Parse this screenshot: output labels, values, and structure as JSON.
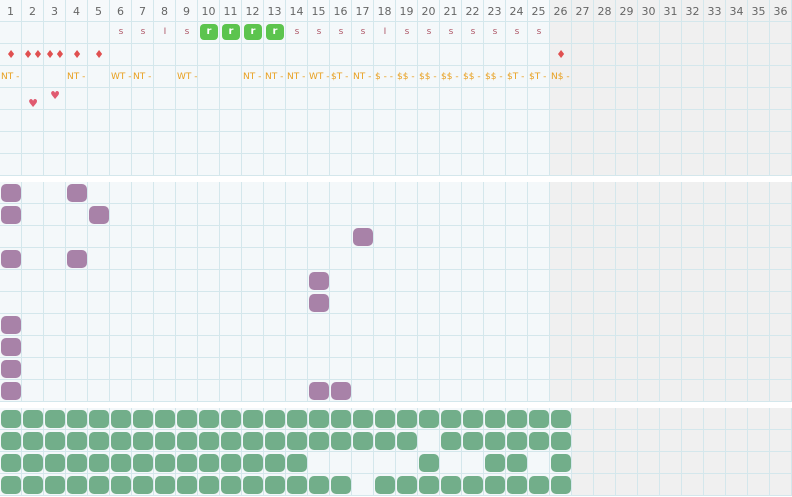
{
  "columns": [
    "1",
    "2",
    "3",
    "4",
    "5",
    "6",
    "7",
    "8",
    "9",
    "10",
    "11",
    "12",
    "13",
    "14",
    "15",
    "16",
    "17",
    "18",
    "19",
    "20",
    "21",
    "22",
    "23",
    "24",
    "25",
    "26",
    "27",
    "28",
    "29",
    "30",
    "31",
    "32",
    "33",
    "34",
    "35",
    "36"
  ],
  "active_columns": 25,
  "colors": {
    "active_bg": "#f4f8fa",
    "inactive_bg": "#f0f0f0",
    "header_bg": "#f6f9fb",
    "green_badge": "#5cc44e",
    "purple_blob": "#a882a8",
    "green_blob": "#72ae8a",
    "code_text": "#e8a020",
    "drop_red": "#e05050",
    "heart_pink": "#e05a70",
    "s_mark": "#b05a6a"
  },
  "top_marks": [
    "",
    "",
    "",
    "",
    "",
    "s",
    "s",
    "I",
    "s",
    "r",
    "r",
    "r",
    "r",
    "s",
    "s",
    "s",
    "s",
    "I",
    "s",
    "s",
    "s",
    "s",
    "s",
    "s",
    "s"
  ],
  "drops": [
    "♦",
    "♦♦",
    "♦♦",
    "♦",
    "♦",
    "",
    "",
    "",
    "",
    "",
    "",
    "",
    "",
    "",
    "",
    "",
    "",
    "",
    "",
    "",
    "",
    "",
    "",
    "",
    "",
    "♦"
  ],
  "codes": [
    "NT -",
    "",
    "",
    "NT -",
    "",
    "WT -",
    "NT -",
    "",
    "WT -",
    "",
    "",
    "NT -",
    "NT -",
    "NT -",
    "WT -",
    "$T -",
    "NT -",
    "$ - -",
    "$$ -",
    "$$ -",
    "$$ -",
    "$$ -",
    "$$ -",
    "$T -",
    "$T -",
    "N$ -"
  ],
  "hearts": [
    {
      "col": 2,
      "sub": 1,
      "symbol": "♥"
    },
    {
      "col": 3,
      "sub": 0,
      "symbol": "♥"
    }
  ],
  "purple_blobs": [
    [
      1,
      1
    ],
    [
      1,
      4
    ],
    [
      2,
      1
    ],
    [
      2,
      5
    ],
    [
      3,
      17
    ],
    [
      4,
      1
    ],
    [
      4,
      4
    ],
    [
      5,
      15
    ],
    [
      6,
      15
    ],
    [
      7,
      1
    ],
    [
      8,
      1
    ],
    [
      9,
      1
    ],
    [
      10,
      1
    ],
    [
      10,
      15
    ],
    [
      10,
      16
    ]
  ],
  "green_rows": [
    [
      1,
      2,
      3,
      4,
      5,
      6,
      7,
      8,
      9,
      10,
      11,
      12,
      13,
      14,
      15,
      16,
      17,
      18,
      19,
      20,
      21,
      22,
      23,
      24,
      25,
      26
    ],
    [
      1,
      2,
      3,
      4,
      5,
      6,
      7,
      8,
      9,
      10,
      11,
      12,
      13,
      14,
      15,
      16,
      17,
      18,
      19,
      21,
      22,
      23,
      24,
      25,
      26
    ],
    [
      1,
      2,
      3,
      4,
      5,
      6,
      7,
      8,
      9,
      10,
      11,
      12,
      13,
      14,
      20,
      23,
      24,
      26
    ],
    [
      1,
      2,
      3,
      4,
      5,
      6,
      7,
      8,
      9,
      10,
      11,
      12,
      13,
      14,
      15,
      16,
      18,
      19,
      20,
      21,
      22,
      23,
      24,
      25,
      26
    ]
  ]
}
